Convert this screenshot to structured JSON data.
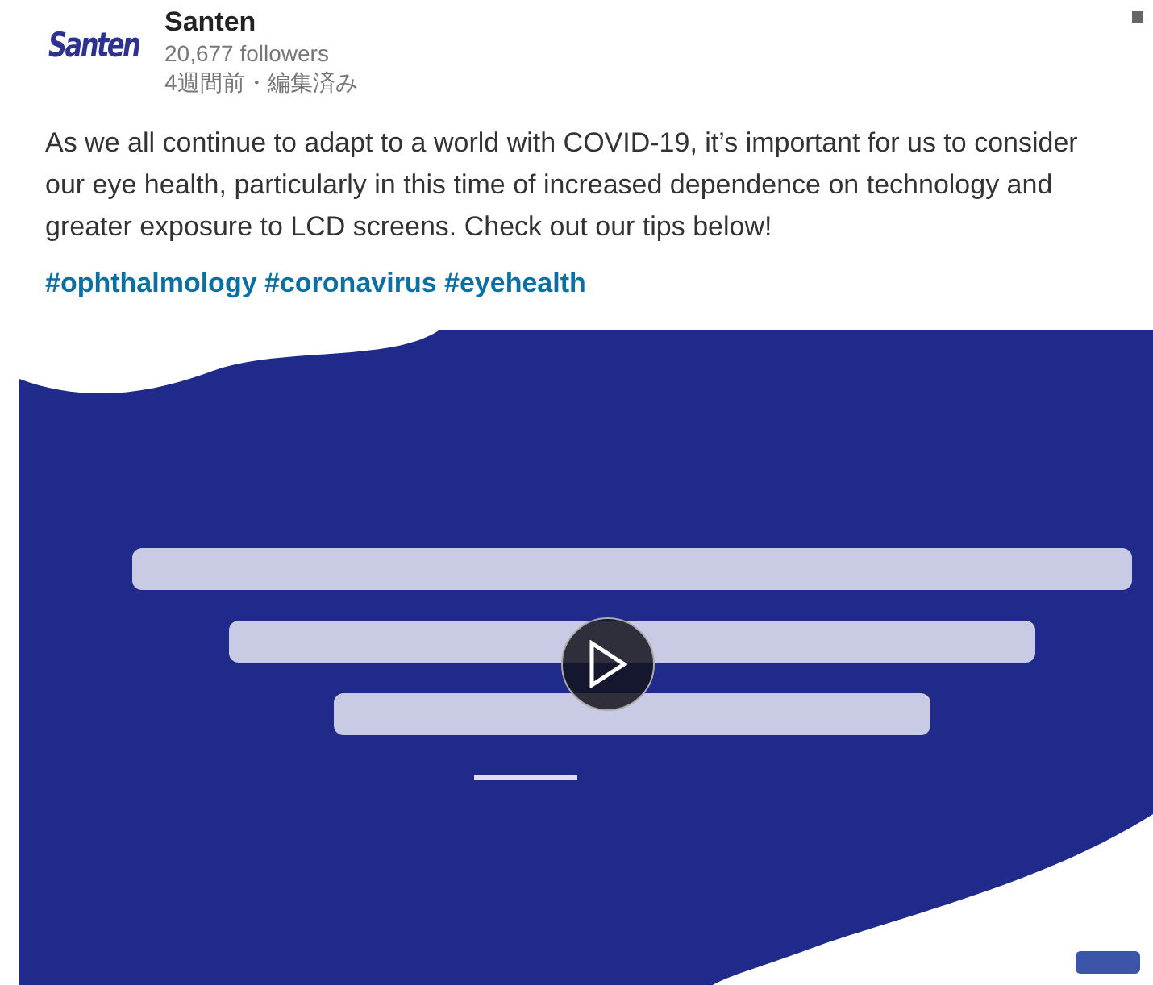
{
  "company": {
    "logo": "Santen",
    "name": "Santen",
    "followers": "20,677 followers",
    "meta": "4週間前・編集済み"
  },
  "post": {
    "text": "As we all continue to adapt to a world with COVID-19, it’s important for us to consider our eye health, particularly in this time of increased dependence on technology and greater exposure to LCD screens. Check out our tips below!",
    "hashtags": [
      "#ophthalmology",
      "#coronavirus",
      "#eyehealth"
    ]
  }
}
